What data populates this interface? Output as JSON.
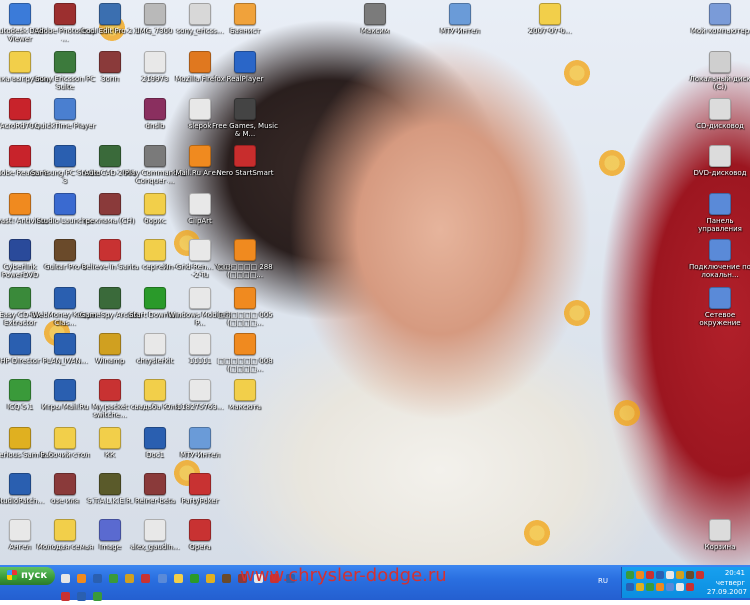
{
  "taskbar": {
    "start_label": "пуск",
    "watermark": "www.chrysler-dodge.ru",
    "lang": "RU",
    "clock": {
      "time": "20:41",
      "day": "четверг",
      "date": "27.09.2007"
    }
  },
  "desktop_icons": [
    {
      "label": "Autodesk DWF Viewer",
      "color": "#3b7bd9"
    },
    {
      "label": "Adobe Photoshop ...",
      "color": "#9c2f2f"
    },
    {
      "label": "Cool Edit Pro 2.1",
      "color": "#3b6fb0"
    },
    {
      "label": "IMG_7300",
      "color": "#b9b9b9"
    },
    {
      "label": "sony_ericss...",
      "color": "#d8d8d8"
    },
    {
      "label": "Баянист",
      "color": "#f0a23b"
    },
    {
      "label": "Максим",
      "color": "#7b7b7b"
    },
    {
      "label": "МТУ-Интел",
      "color": "#6a9bd8"
    },
    {
      "label": "2007-07-0...",
      "color": "#f2cf4a"
    },
    {
      "label": "Мой компьютер",
      "color": "#7a9bd8"
    },
    {
      "label": "Папка выгрузки...",
      "color": "#f2cf4a"
    },
    {
      "label": "Sony Ericsson PC Suite",
      "color": "#3c7a3c"
    },
    {
      "label": "3опп",
      "color": "#8a3a3a"
    },
    {
      "label": "219973",
      "color": "#e8e8e8"
    },
    {
      "label": "Mozilla Firefox",
      "color": "#e0781f"
    },
    {
      "label": "RealPlayer",
      "color": "#2a66c8"
    },
    {
      "label": "Локальный диск (C:)",
      "color": "#cfcfcf"
    },
    {
      "label": "AcroRd70...",
      "color": "#c8232b"
    },
    {
      "label": "QuickTime Player",
      "color": "#4a7fd0"
    },
    {
      "label": "dnslb",
      "color": "#8a2f5f"
    },
    {
      "label": "slepok",
      "color": "#e8e8e8"
    },
    {
      "label": "Free Games, Music & M...",
      "color": "#444444"
    },
    {
      "label": "CD-дисковод",
      "color": "#dcdcdc"
    },
    {
      "label": "Adobe Reader 8",
      "color": "#c8232b"
    },
    {
      "label": "Samsung PC Studio 3",
      "color": "#2a5fb0"
    },
    {
      "label": "AutoCAD 2007",
      "color": "#3a6a3a"
    },
    {
      "label": "Play Command & Conquer ...",
      "color": "#7a7a7a"
    },
    {
      "label": "Mail.Ru Агент",
      "color": "#f08a1f"
    },
    {
      "label": "Nero StartSmart",
      "color": "#c82d2d"
    },
    {
      "label": "DVD-дисковод",
      "color": "#dcdcdc"
    },
    {
      "label": "avast! Antivirus",
      "color": "#f08a1f"
    },
    {
      "label": "Studio Launcher",
      "color": "#3a6ad0"
    },
    {
      "label": "реклама (СН)",
      "color": "#8a3a3a"
    },
    {
      "label": "борис",
      "color": "#f2cf4a"
    },
    {
      "label": "ClipArt",
      "color": "#e8e8e8"
    },
    {
      "label": "Панель управления",
      "color": "#5a8ad8"
    },
    {
      "label": "Cyberlink PowerDVD",
      "color": "#2a4a9a"
    },
    {
      "label": "Guitar Pro 4",
      "color": "#6a4a2a"
    },
    {
      "label": "Believe in Santa",
      "color": "#c83232"
    },
    {
      "label": "сергей",
      "color": "#f2cf4a"
    },
    {
      "label": "In-Grid-Ren... Yous--2-Tu",
      "color": "#e8e8e8"
    },
    {
      "label": "□□□□□□ 288 (□□□□...",
      "color": "#f08a1f"
    },
    {
      "label": "Подключение по локальн...",
      "color": "#5a8ad8"
    },
    {
      "label": "Easy CD-DA Extractor",
      "color": "#3a8a3a"
    },
    {
      "label": "WebMoney Keeper Clas...",
      "color": "#2a5fb0"
    },
    {
      "label": "GameSpy Arcade",
      "color": "#3a6a3a"
    },
    {
      "label": "Start Downlo...",
      "color": "#2a9a2a"
    },
    {
      "label": "Windows Mobile® P...",
      "color": "#e8e8e8"
    },
    {
      "label": "□□□□□□ 005 (□□□□...",
      "color": "#f08a1f"
    },
    {
      "label": "Сетевое окружение",
      "color": "#5a8ad8"
    },
    {
      "label": "HP Director",
      "color": "#2a5fb0"
    },
    {
      "label": "PLAN_IVAN...",
      "color": "#2a5fb0"
    },
    {
      "label": "Winamp",
      "color": "#d0a020"
    },
    {
      "label": "chryslerkit",
      "color": "#e8e8e8"
    },
    {
      "label": "11111",
      "color": "#e8e8e8"
    },
    {
      "label": "□□□□□□ 008 (□□□□...",
      "color": "#f08a1f"
    },
    {
      "label": "ICQ 5.1",
      "color": "#3a9a3a"
    },
    {
      "label": "Игры Mail.Ru",
      "color": "#2a5fb0"
    },
    {
      "label": "My packet switche...",
      "color": "#c83232"
    },
    {
      "label": "свадьба Юли",
      "color": "#f2cf4a"
    },
    {
      "label": "118275763...",
      "color": "#e8e8e8"
    },
    {
      "label": "максюта",
      "color": "#f2cf4a"
    },
    {
      "label": "Serious Sam 2",
      "color": "#e0b020"
    },
    {
      "label": "Рабочий стол",
      "color": "#f2cf4a"
    },
    {
      "label": "КК",
      "color": "#f2cf4a"
    },
    {
      "label": "Doc1",
      "color": "#2a5fb0"
    },
    {
      "label": "МТУ-Интел",
      "color": "#6a9bd8"
    },
    {
      "label": "StudioPatch...",
      "color": "#2a5fb0"
    },
    {
      "label": "озе иля",
      "color": "#8a3a3a"
    },
    {
      "label": "S.T.A.L.K.E.R.",
      "color": "#5a5a2a"
    },
    {
      "label": "Reiner-beta",
      "color": "#8a3a3a"
    },
    {
      "label": "PartyPoker",
      "color": "#c83232"
    },
    {
      "label": "Ангел",
      "color": "#e8e8e8"
    },
    {
      "label": "Молодая семья",
      "color": "#f2cf4a"
    },
    {
      "label": "Image",
      "color": "#5a6ad0"
    },
    {
      "label": "alex_gaudin...",
      "color": "#e8e8e8"
    },
    {
      "label": "Opera",
      "color": "#c83232"
    },
    {
      "label": "Корзина",
      "color": "#dcdcdc"
    }
  ]
}
